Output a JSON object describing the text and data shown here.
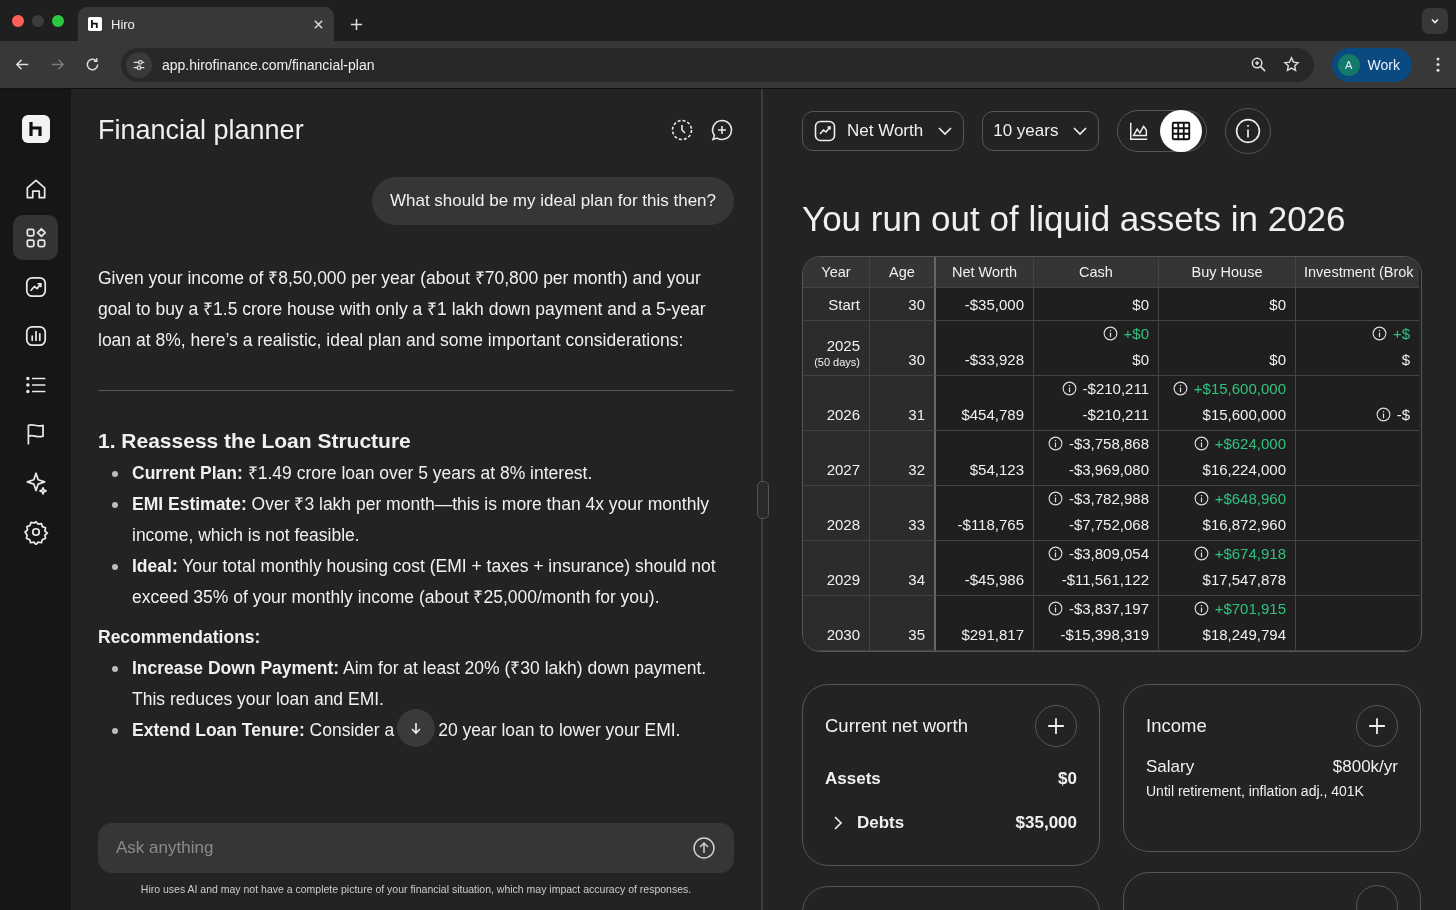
{
  "browser": {
    "tabs": [
      {
        "title": "Hiro",
        "selected": true
      }
    ],
    "url": "app.hirofinance.com/financial-plan",
    "forward_disabled": true,
    "profile": {
      "initial": "A",
      "label": "Work"
    }
  },
  "sidebar": {
    "items": [
      {
        "selected": false
      },
      {
        "selected": true
      },
      {
        "selected": false
      },
      {
        "selected": false
      },
      {
        "selected": false
      },
      {
        "selected": false
      },
      {
        "selected": false
      },
      {
        "selected": false
      }
    ]
  },
  "chat": {
    "title": "Financial planner",
    "user_message": "What should be my ideal plan for this then?",
    "answer": [
      {
        "kind": "paragraph",
        "text": "Given your income of ₹8,50,000 per year (about ₹70,800 per month) and your goal to buy a ₹1.5 crore house with only a ₹1 lakh down payment and a 5-year loan at 8%, here’s a realistic, ideal plan and some important considerations:"
      },
      {
        "kind": "divider"
      },
      {
        "kind": "heading",
        "text": "1. Reassess the Loan Structure"
      },
      {
        "kind": "bullets",
        "items": [
          {
            "text": "**Current Plan:** ₹1.49 crore loan over 5 years at 8% interest."
          },
          {
            "text": "**EMI Estimate:** Over ₹3 lakh per month—this is more than 4x your monthly income, which is not feasible."
          },
          {
            "text": "**Ideal:** Your total monthly housing cost (EMI + taxes + insurance) should not exceed 35% of your monthly income (about ₹25,000/month for you)."
          }
        ]
      },
      {
        "kind": "label",
        "text": "Recommendations:"
      },
      {
        "kind": "bullets",
        "items": [
          {
            "text": "**Increase Down Payment:** Aim for at least 20% (₹30 lakh) down payment. This reduces your loan and EMI."
          },
          {
            "text": "**Extend Loan Tenure:** Consider a",
            "text_after": "20 year loan to lower your EMI."
          }
        ]
      }
    ],
    "input": {
      "placeholder": "Ask anything"
    },
    "disclaimer": "Hiro uses AI and may not have a complete picture of your financial situation, which may impact accuracy of responses."
  },
  "planner": {
    "metric": "Net Worth",
    "range": "10 years",
    "views": [
      {
        "kind": "chart",
        "selected": false
      },
      {
        "kind": "table",
        "selected": true
      }
    ],
    "headline": "You run out of liquid assets in 2026",
    "table": {
      "columns": [
        "Year",
        "Age",
        "Net Worth",
        "Cash",
        "Buy House",
        "Investment (Brok"
      ],
      "rows": [
        {
          "year": "Start",
          "age": "30",
          "net_worth": "-$35,000",
          "cash": {
            "value": "$0"
          },
          "house": {
            "value": "$0"
          },
          "invest": {}
        },
        {
          "year": "2025",
          "note": "(50 days)",
          "age": "30",
          "net_worth": "-$33,928",
          "cash": {
            "change": "+$0",
            "gain": true,
            "value": "$0"
          },
          "house": {
            "value": "$0"
          },
          "invest": {
            "change": "+$",
            "gain": true,
            "value": "$"
          }
        },
        {
          "year": "2026",
          "age": "31",
          "net_worth": "$454,789",
          "cash": {
            "change": "-$210,211",
            "gain": false,
            "value": "-$210,211"
          },
          "house": {
            "change": "+$15,600,000",
            "gain": true,
            "value": "$15,600,000"
          },
          "invest": {
            "change": "-$",
            "gain": false
          }
        },
        {
          "year": "2027",
          "age": "32",
          "net_worth": "$54,123",
          "cash": {
            "change": "-$3,758,868",
            "gain": false,
            "value": "-$3,969,080"
          },
          "house": {
            "change": "+$624,000",
            "gain": true,
            "value": "$16,224,000"
          },
          "invest": {}
        },
        {
          "year": "2028",
          "age": "33",
          "net_worth": "-$118,765",
          "cash": {
            "change": "-$3,782,988",
            "gain": false,
            "value": "-$7,752,068"
          },
          "house": {
            "change": "+$648,960",
            "gain": true,
            "value": "$16,872,960"
          },
          "invest": {}
        },
        {
          "year": "2029",
          "age": "34",
          "net_worth": "-$45,986",
          "cash": {
            "change": "-$3,809,054",
            "gain": false,
            "value": "-$11,561,122"
          },
          "house": {
            "change": "+$674,918",
            "gain": true,
            "value": "$17,547,878"
          },
          "invest": {}
        },
        {
          "year": "2030",
          "age": "35",
          "net_worth": "$291,817",
          "cash": {
            "change": "-$3,837,197",
            "gain": false,
            "value": "-$15,398,319"
          },
          "house": {
            "change": "+$701,915",
            "gain": true,
            "value": "$18,249,794"
          },
          "invest": {}
        }
      ]
    },
    "cards": [
      {
        "kind": "net_worth",
        "title": "Current net worth",
        "rows": [
          {
            "label": "Assets",
            "value": "$0",
            "expandable": false
          },
          {
            "label": "Debts",
            "value": "$35,000",
            "expandable": true
          }
        ]
      },
      {
        "kind": "income",
        "title": "Income",
        "rows": [
          {
            "label": "Salary",
            "value": "$800k/yr",
            "detail": "Until retirement, inflation adj., 401K"
          }
        ]
      }
    ]
  }
}
